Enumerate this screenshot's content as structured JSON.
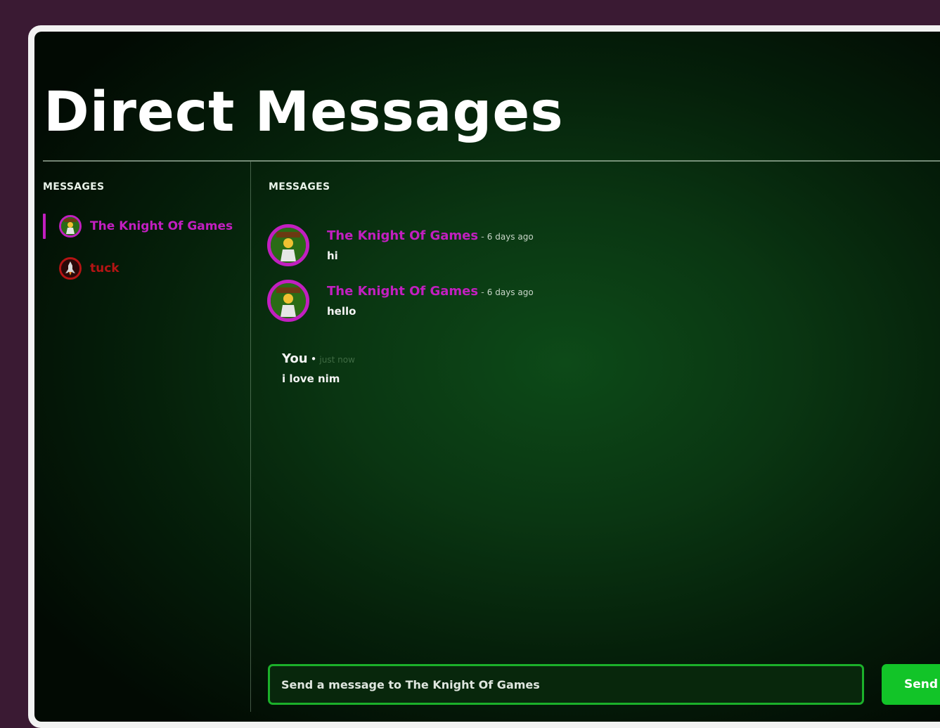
{
  "page": {
    "title": "Direct Messages"
  },
  "sidebar": {
    "heading": "MESSAGES",
    "items": [
      {
        "name": "The Knight Of Games",
        "active": true,
        "name_color": "#c21fc0",
        "avatar": "knight-avatar-icon"
      },
      {
        "name": "tuck",
        "active": false,
        "name_color": "#b51414",
        "avatar": "rocket-avatar-icon"
      }
    ]
  },
  "thread": {
    "heading": "MESSAGES",
    "messages": [
      {
        "author": "The Knight Of Games",
        "time": "6 days ago",
        "text": "hi"
      },
      {
        "author": "The Knight Of Games",
        "time": "6 days ago",
        "text": "hello"
      },
      {
        "author": "You",
        "time": "just now",
        "text": "i love nim"
      }
    ]
  },
  "composer": {
    "placeholder": "Send a message to The Knight Of Games",
    "send_label": "Send"
  },
  "colors": {
    "accent_magenta": "#c21fc0",
    "accent_green": "#12c428",
    "frame_bg": "#3a1a33"
  }
}
